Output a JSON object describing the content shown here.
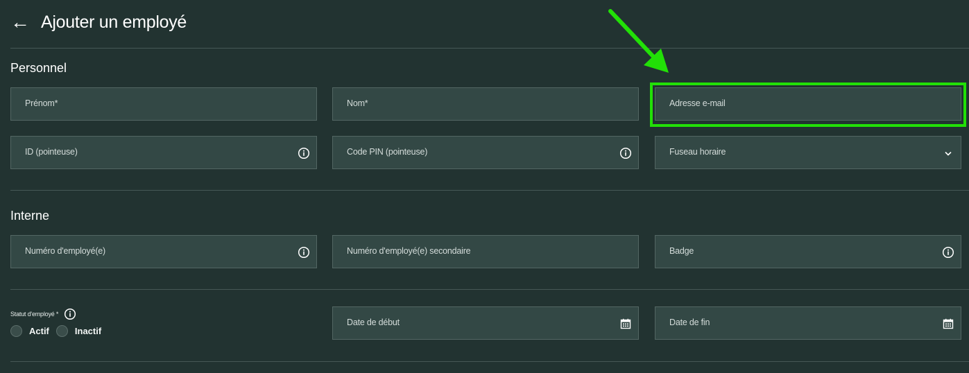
{
  "header": {
    "back_icon": "←",
    "title": "Ajouter un employé"
  },
  "sections": {
    "personnel": "Personnel",
    "interne": "Interne"
  },
  "fields": {
    "prenom": "Prénom*",
    "nom": "Nom*",
    "email": "Adresse e-mail",
    "id_pointeuse": "ID (pointeuse)",
    "code_pin": "Code PIN (pointeuse)",
    "fuseau": "Fuseau horaire",
    "numero_employe": "Numéro d'employé(e)",
    "numero_secondaire": "Numéro d'employé(e) secondaire",
    "badge": "Badge",
    "date_debut": "Date de début",
    "date_fin": "Date de fin"
  },
  "status": {
    "label": "Statut d'employé *",
    "options": [
      "Actif",
      "Inactif"
    ]
  },
  "icons": {
    "back": "back-arrow-icon",
    "info": "info-icon",
    "chevron": "chevron-down-icon",
    "calendar": "calendar-icon"
  },
  "colors": {
    "background": "#223331",
    "field_bg": "#334845",
    "field_border": "#536663",
    "highlight": "#22e007"
  }
}
